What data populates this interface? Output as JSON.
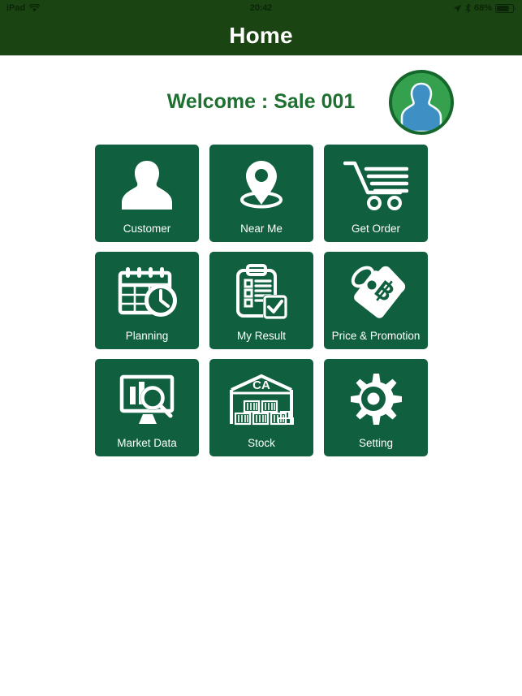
{
  "status_bar": {
    "carrier": "iPad",
    "wifi_icon": "wifi-icon",
    "time": "20:42",
    "location_icon": "location-arrow-icon",
    "bluetooth_icon": "bluetooth-icon",
    "battery_percent": "68%",
    "battery_icon": "battery-icon"
  },
  "nav": {
    "title": "Home"
  },
  "header": {
    "welcome": "Welcome : Sale 001",
    "avatar_icon": "user-avatar-icon"
  },
  "colors": {
    "nav_green": "#1a4411",
    "tile_green": "#10603f",
    "welcome_green": "#1d7030",
    "avatar_ring": "#15672b",
    "avatar_fill": "#35a04e",
    "avatar_person": "#3d8fc4",
    "page_background": "#ffffff"
  },
  "tiles": [
    {
      "label": "Customer",
      "icon": "person-silhouette-icon"
    },
    {
      "label": "Near Me",
      "icon": "map-pin-icon"
    },
    {
      "label": "Get Order",
      "icon": "shopping-cart-icon"
    },
    {
      "label": "Planning",
      "icon": "calendar-clock-icon"
    },
    {
      "label": "My Result",
      "icon": "clipboard-check-icon"
    },
    {
      "label": "Price & Promotion",
      "icon": "price-tag-baht-icon"
    },
    {
      "label": "Market Data",
      "icon": "monitor-chart-magnifier-icon"
    },
    {
      "label": "Stock",
      "icon": "warehouse-crates-icon",
      "sign_text": "CA"
    },
    {
      "label": "Setting",
      "icon": "gear-icon"
    }
  ]
}
